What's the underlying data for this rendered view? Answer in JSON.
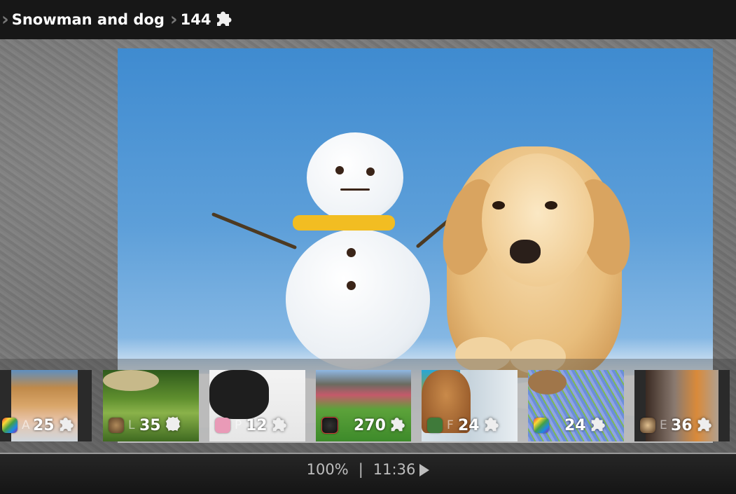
{
  "header": {
    "breadcrumb": [
      {
        "label": "Snowman and dog"
      },
      {
        "label": "144"
      }
    ],
    "piece_icon": "puzzle-piece-icon"
  },
  "main": {
    "image_description": "Snowman with yellow scarf next to golden retriever puppy in snow"
  },
  "thumbnails": [
    {
      "subject": "dog and sleeping baby",
      "app_icon": "rainbow-app-icon",
      "letter": "A",
      "count": "25",
      "piece_icon": "puzzle-piece-icon"
    },
    {
      "subject": "frog on moss",
      "app_icon": "cat-app-icon",
      "letter": "L",
      "count": "35",
      "piece_icon": "leather-piece-icon"
    },
    {
      "subject": "pug in snow",
      "app_icon": "pink-app-icon",
      "letter": "P",
      "count": "12",
      "piece_icon": "puzzle-piece-icon"
    },
    {
      "subject": "dog in garden",
      "app_icon": "ladybug-app-icon",
      "letter": "",
      "count": "270",
      "piece_icon": "puzzle-piece-icon"
    },
    {
      "subject": "cat by window with sweaters",
      "app_icon": "bird-app-icon",
      "letter": "F",
      "count": "24",
      "piece_icon": "puzzle-piece-icon"
    },
    {
      "subject": "chipmunk in flowers",
      "app_icon": "rainbow-app-icon",
      "letter": "",
      "count": "24",
      "piece_icon": "puzzle-piece-icon"
    },
    {
      "subject": "autumn snowy forest road",
      "app_icon": "lynx-app-icon",
      "letter": "E",
      "count": "36",
      "piece_icon": "puzzle-piece-icon"
    }
  ],
  "status": {
    "zoom": "100%",
    "separator": "|",
    "time": "11:36",
    "play_icon": "play-icon"
  }
}
